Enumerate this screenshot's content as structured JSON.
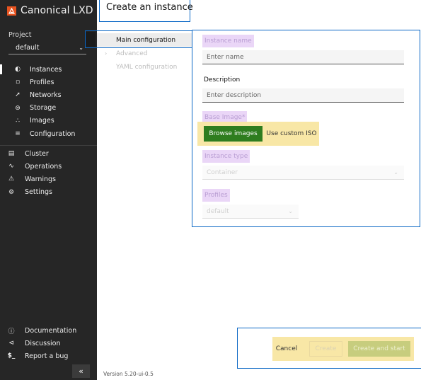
{
  "brand": {
    "name": "Canonical LXD"
  },
  "project": {
    "label": "Project",
    "value": "default"
  },
  "nav": {
    "project_items": [
      {
        "label": "Instances",
        "icon": "instances-icon",
        "active": true
      },
      {
        "label": "Profiles",
        "icon": "profiles-icon"
      },
      {
        "label": "Networks",
        "icon": "networks-icon"
      },
      {
        "label": "Storage",
        "icon": "storage-icon"
      },
      {
        "label": "Images",
        "icon": "images-icon"
      },
      {
        "label": "Configuration",
        "icon": "configuration-icon"
      }
    ],
    "global_items": [
      {
        "label": "Cluster",
        "icon": "cluster-icon"
      },
      {
        "label": "Operations",
        "icon": "operations-icon"
      },
      {
        "label": "Warnings",
        "icon": "warning-icon"
      },
      {
        "label": "Settings",
        "icon": "gear-icon"
      }
    ],
    "footer_items": [
      {
        "label": "Documentation",
        "icon": "info-icon"
      },
      {
        "label": "Discussion",
        "icon": "share-icon"
      },
      {
        "label": "Report a bug",
        "icon": "terminal-icon"
      }
    ],
    "collapse_glyph": "«"
  },
  "page": {
    "title": "Create an instance"
  },
  "config_menu": {
    "items": [
      {
        "label": "Main configuration",
        "active": true
      },
      {
        "label": "Advanced"
      },
      {
        "label": "YAML configuration"
      }
    ]
  },
  "form": {
    "name_label": "Instance name",
    "name_placeholder": "Enter name",
    "description_label": "Description",
    "description_placeholder": "Enter description",
    "base_image_label": "Base Image*",
    "browse_images_label": "Browse images",
    "custom_iso_label": "Use custom ISO",
    "instance_type_label": "Instance type",
    "instance_type_value": "Container",
    "profiles_label": "Profiles",
    "profiles_value": "default"
  },
  "footer": {
    "cancel_label": "Cancel",
    "create_label": "Create",
    "create_start_label": "Create and start",
    "version": "Version 5.20-ui-0.5"
  },
  "colors": {
    "sidebar_bg": "#262626",
    "brand_accent": "#e95420",
    "primary_button": "#2e7d1f",
    "focus_outline": "#0a67c5",
    "label_highlight": "#ead6f7",
    "button_highlight": "#f8e7a6"
  }
}
